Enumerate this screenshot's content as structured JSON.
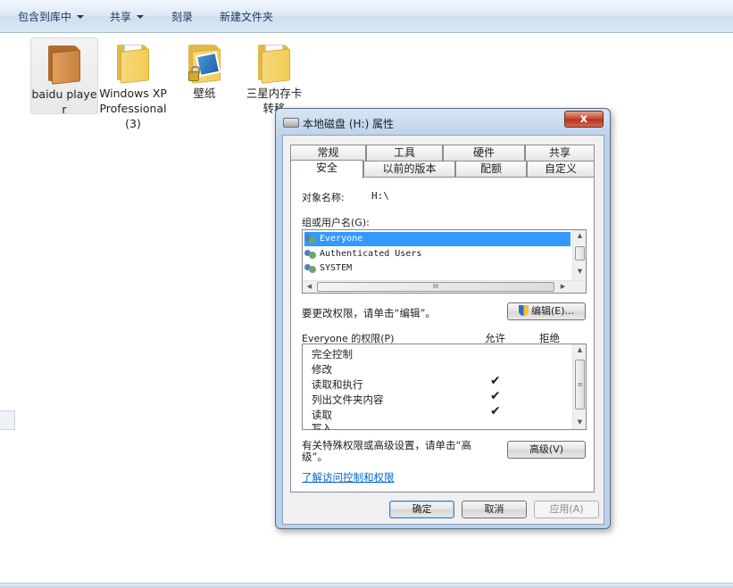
{
  "toolbar": {
    "items": [
      {
        "label": "包含到库中",
        "dropdown": true
      },
      {
        "label": "共享",
        "dropdown": true
      },
      {
        "label": "刻录",
        "dropdown": false
      },
      {
        "label": "新建文件夹",
        "dropdown": false
      }
    ]
  },
  "folders": [
    {
      "label": "baidu player",
      "icon": "folder-orange-icon",
      "selected": true
    },
    {
      "label": "Windows XP Professional (3)",
      "icon": "folder-yellow-icon",
      "selected": false
    },
    {
      "label": "壁纸",
      "icon": "folder-locked-icon",
      "selected": false
    },
    {
      "label": "三星内存卡转移",
      "icon": "folder-yellow-icon",
      "selected": false
    }
  ],
  "dialog": {
    "title": "本地磁盘 (H:) 属性",
    "close_label": "x",
    "tabs_row1": [
      "常规",
      "工具",
      "硬件",
      "共享"
    ],
    "tabs_row2": [
      "安全",
      "以前的版本",
      "配额",
      "自定义"
    ],
    "active_tab": "安全",
    "object_label": "对象名称:",
    "object_value": "H:\\",
    "groups_label": "组或用户名(G):",
    "users": [
      "Everyone",
      "Authenticated Users",
      "SYSTEM"
    ],
    "selected_user": "Everyone",
    "change_hint": "要更改权限，请单击“编辑”。",
    "edit_button": "编辑(E)...",
    "perm_header": "Everyone 的权限(P)",
    "allow_header": "允许",
    "deny_header": "拒绝",
    "permissions": [
      {
        "name": "完全控制",
        "allow": false,
        "deny": false
      },
      {
        "name": "修改",
        "allow": false,
        "deny": false
      },
      {
        "name": "读取和执行",
        "allow": true,
        "deny": false
      },
      {
        "name": "列出文件夹内容",
        "allow": true,
        "deny": false
      },
      {
        "name": "读取",
        "allow": true,
        "deny": false
      },
      {
        "name": "写入",
        "allow": false,
        "deny": false
      }
    ],
    "check_glyph": "✔",
    "advanced_hint_line1": "有关特殊权限或高级设置，请单击“高",
    "advanced_hint_line2": "级”。",
    "advanced_button": "高级(V)",
    "learn_link": "了解访问控制和权限",
    "ok_button": "确定",
    "cancel_button": "取消",
    "apply_button": "应用(A)",
    "hscroll_grip": "III",
    "vscroll_grip": "≡"
  },
  "colors": {
    "toolbar_text": "#1e395b",
    "selection": "#3399ff",
    "link": "#0066cc",
    "dialog_frame": "#b9d1ea"
  }
}
